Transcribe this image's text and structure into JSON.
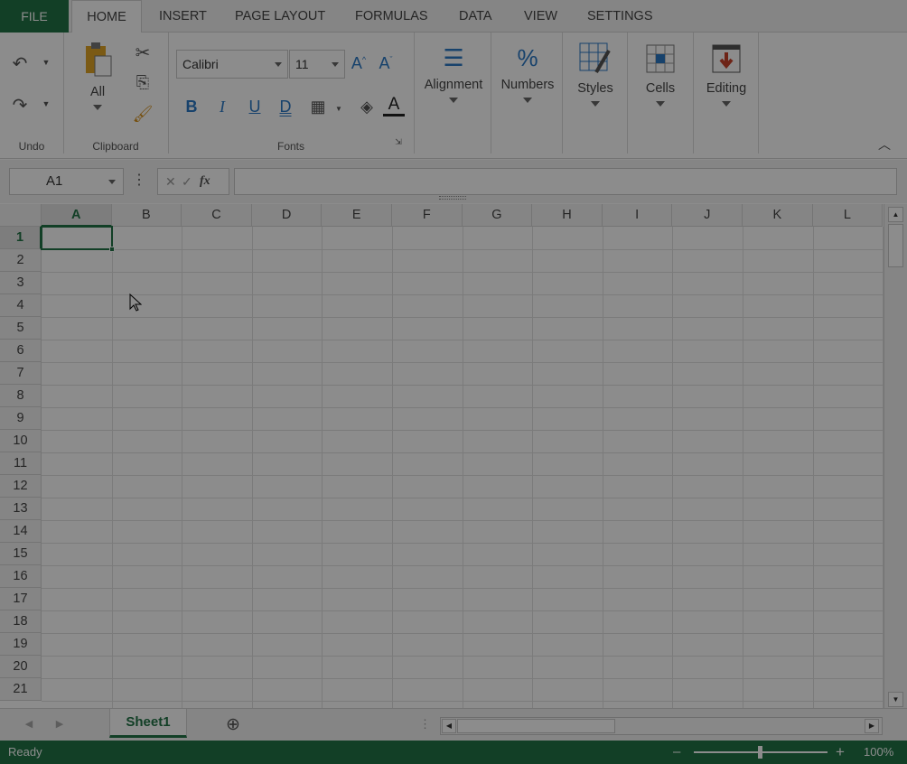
{
  "tabs": {
    "file": "FILE",
    "home": "HOME",
    "insert": "INSERT",
    "page_layout": "PAGE LAYOUT",
    "formulas": "FORMULAS",
    "data": "DATA",
    "view": "VIEW",
    "settings": "SETTINGS"
  },
  "ribbon": {
    "undo_group": "Undo",
    "clipboard_group": "Clipboard",
    "paste_label": "All",
    "fonts_group": "Fonts",
    "font_name": "Calibri",
    "font_size": "11",
    "bold": "B",
    "italic": "I",
    "underline": "U",
    "double_underline": "D",
    "alignment": "Alignment",
    "numbers": "Numbers",
    "numbers_symbol": "%",
    "styles": "Styles",
    "cells": "Cells",
    "editing": "Editing"
  },
  "formula_bar": {
    "name_box": "A1",
    "fx": "fx",
    "value": ""
  },
  "columns": [
    "A",
    "B",
    "C",
    "D",
    "E",
    "F",
    "G",
    "H",
    "I",
    "J",
    "K",
    "L"
  ],
  "rows": [
    "1",
    "2",
    "3",
    "4",
    "5",
    "6",
    "7",
    "8",
    "9",
    "10",
    "11",
    "12",
    "13",
    "14",
    "15",
    "16",
    "17",
    "18",
    "19",
    "20",
    "21"
  ],
  "selected_cell": "A1",
  "sheet_tab": "Sheet1",
  "status": {
    "text": "Ready",
    "zoom": "100%"
  },
  "colors": {
    "accent": "#217346",
    "overlay": "rgba(0,0,0,0.45)"
  }
}
